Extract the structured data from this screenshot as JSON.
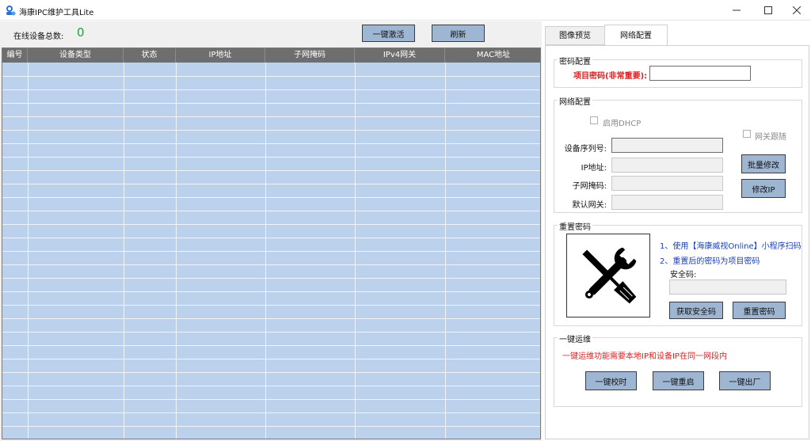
{
  "window": {
    "title": "海康IPC维护工具Lite"
  },
  "left": {
    "online_label": "在线设备总数:",
    "online_count": "0",
    "activate_button": "一键激活",
    "refresh_button": "刷新",
    "columns": [
      "编号",
      "设备类型",
      "状态",
      "IP地址",
      "子网掩码",
      "IPv4网关",
      "MAC地址"
    ]
  },
  "tabs": {
    "preview": "图像预览",
    "network": "网络配置"
  },
  "password_group": {
    "title": "密码配置",
    "project_password_label": "项目密码(非常重要):",
    "project_password_value": ""
  },
  "network_group": {
    "title": "网络配置",
    "dhcp_label": "启用DHCP",
    "gateway_follow_label": "网关跟随",
    "serial_label": "设备序列号:",
    "ip_label": "IP地址:",
    "mask_label": "子网掩码:",
    "gateway_label": "默认网关:",
    "batch_modify_button": "批量修改",
    "modify_ip_button": "修改IP"
  },
  "reset_group": {
    "title": "重置密码",
    "tip1": "1、使用【海康威视Online】小程序扫码",
    "tip2": "2、重置后的密码为项目密码",
    "security_code_label": "安全码:",
    "get_code_button": "获取安全码",
    "reset_button": "重置密码"
  },
  "ops_group": {
    "title": "一键运维",
    "warning": "一键运维功能需要本地IP和设备IP在同一网段内",
    "time_sync_button": "一键校时",
    "reboot_button": "一键重启",
    "factory_button": "一键出厂"
  },
  "colors": {
    "button_bg": "#9fb6d3",
    "grid_bg": "#bcd1ec",
    "header_bg": "#6e6e6e",
    "count_green": "#1f9d3a",
    "warning_red": "#e02020",
    "tip_blue": "#1a3fb8"
  },
  "icons": {
    "app": "camera-person-icon",
    "tools": "wrench-screwdriver-icon"
  }
}
